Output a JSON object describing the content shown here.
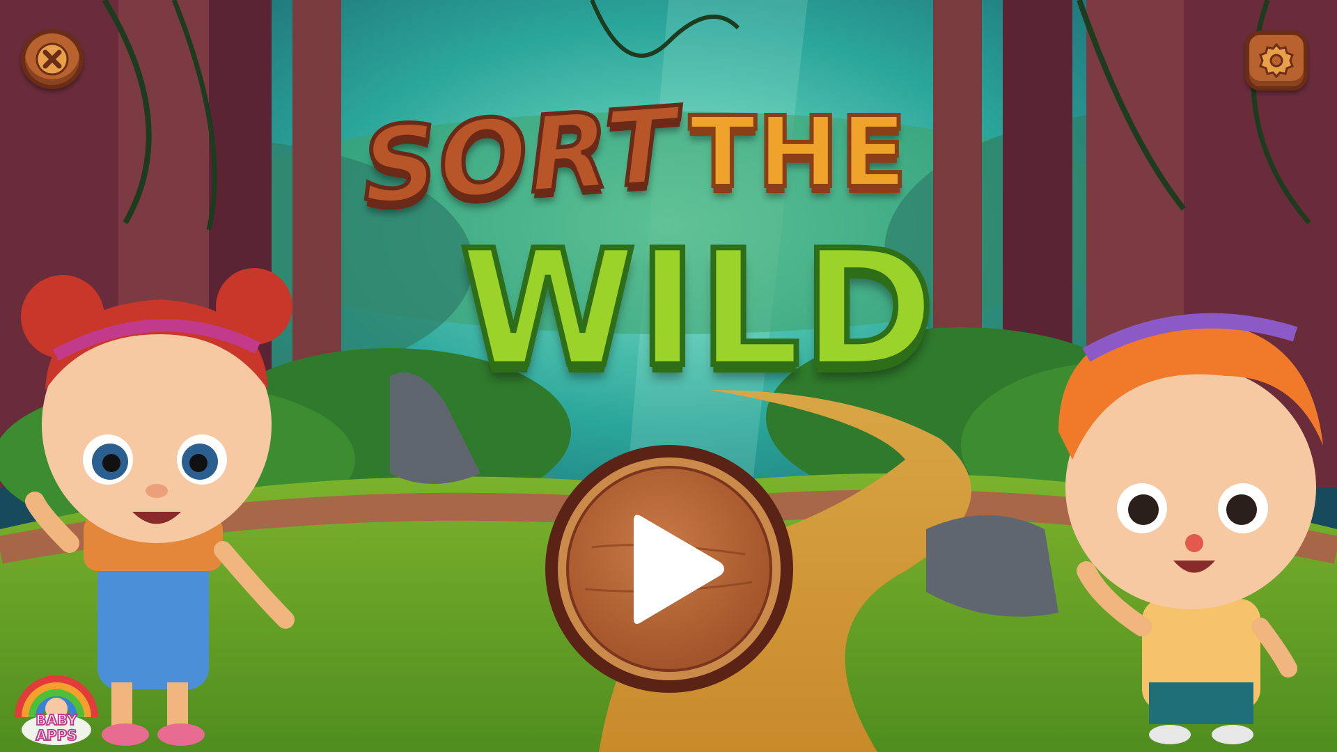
{
  "title": {
    "line1_word1": "SORT",
    "line1_word2": "THE",
    "line2": "WILD"
  },
  "buttons": {
    "close_icon": "close-x-icon",
    "settings_icon": "gear-icon",
    "play_icon": "play-triangle-icon"
  },
  "logo": {
    "line1": "BABY",
    "line2": "APPS"
  },
  "colors": {
    "wood": "#b8632f",
    "wood_dark": "#6b2d16",
    "title_green": "#9bd32a",
    "title_orange": "#f0a32b",
    "title_brown": "#b8562a"
  }
}
